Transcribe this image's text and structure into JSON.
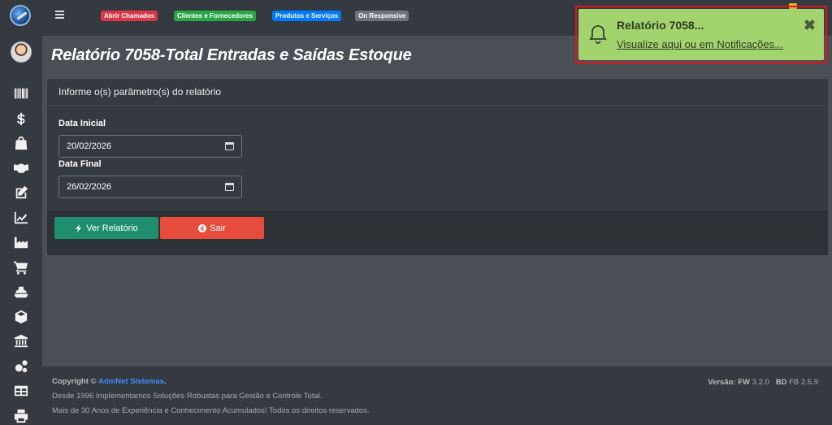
{
  "topbar": {
    "pills": [
      "Abrir Chamados",
      "Clientes e Fornecedores",
      "Produtos e Serviços",
      "On Responsive"
    ]
  },
  "page": {
    "title": "Relatório 7058-Total Entradas e Saídas Estoque"
  },
  "card": {
    "header": "Informe o(s) parâmetro(s) do relatório",
    "fields": [
      {
        "label": "Data Inicial",
        "value": "20/02/2026"
      },
      {
        "label": "Data Final",
        "value": "26/02/2026"
      }
    ],
    "buttons": {
      "report": "Ver Relatório",
      "exit": "Sair"
    }
  },
  "footer": {
    "copyright_prefix": "Copyright ©",
    "company": "AdmNet Sistemas",
    "period": ".",
    "line2": "Desde 1996 Implementamos Soluções Robustas para Gestão e Controle Total.",
    "line3": "Mais de 30 Anos de Experiência e Conhecimento Acumulados! Todos os direitos reservados.",
    "version_label": "Versão:",
    "fw_label": "FW",
    "fw_value": "3.2.0",
    "bd_label": "BD",
    "bd_value": "FB 2.5.9"
  },
  "notification": {
    "title": "Relatório 7058...",
    "link": "Visualize aqui ou em Notificações...",
    "close": "✖"
  },
  "sidebar_icons": [
    "barcode-icon",
    "dollar-icon",
    "shopping-bag-icon",
    "handshake-icon",
    "edit-icon",
    "line-chart-icon",
    "industry-icon",
    "cart-icon",
    "truck-icon",
    "cube-icon",
    "bank-icon",
    "cogs-icon",
    "table-icon",
    "print-icon"
  ],
  "colors": {
    "success": "#1e8e6e",
    "danger": "#e74c3c",
    "toast": "#a3d36f",
    "highlight_border": "#e0161d"
  }
}
